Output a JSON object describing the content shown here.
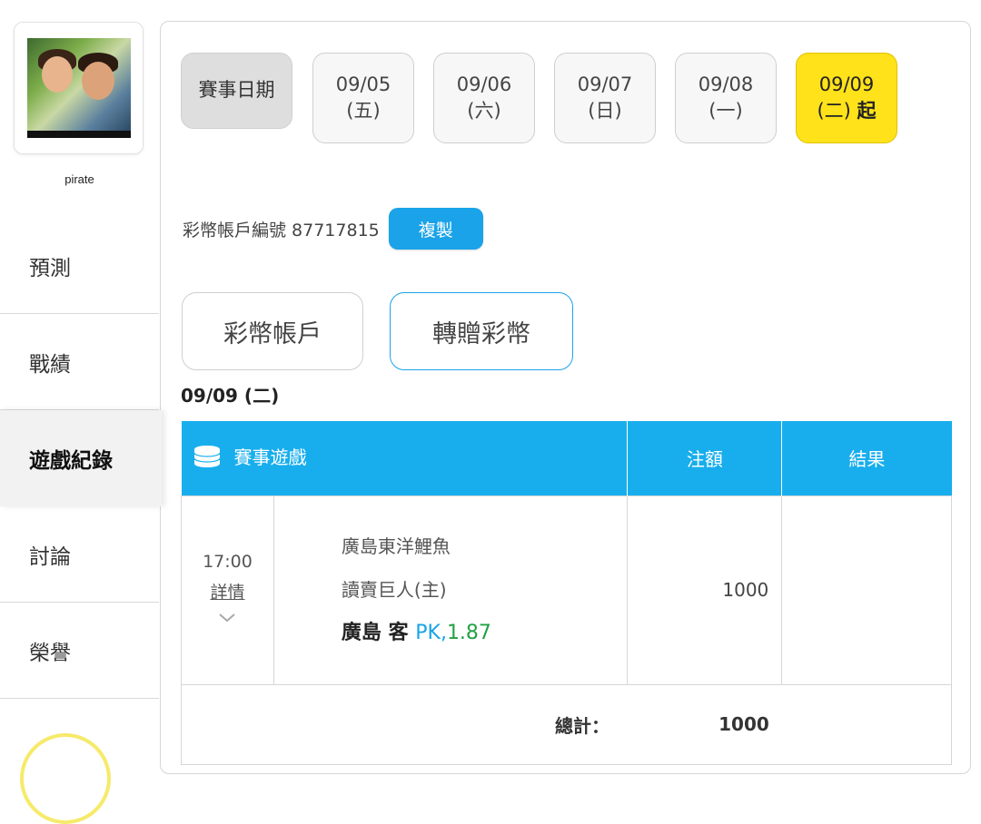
{
  "user": {
    "name": "pirate"
  },
  "nav": {
    "items": [
      {
        "label": "預測"
      },
      {
        "label": "戰績"
      },
      {
        "label": "遊戲紀錄"
      },
      {
        "label": "討論"
      },
      {
        "label": "榮譽"
      }
    ],
    "active": "遊戲紀錄"
  },
  "dates": {
    "label": "賽事日期",
    "items": [
      {
        "date": "09/05",
        "weekday": "(五)"
      },
      {
        "date": "09/06",
        "weekday": "(六)"
      },
      {
        "date": "09/07",
        "weekday": "(日)"
      },
      {
        "date": "09/08",
        "weekday": "(一)"
      },
      {
        "date": "09/09",
        "weekday": "(二)",
        "suffix": "起"
      }
    ],
    "selected": "09/09"
  },
  "account": {
    "label": "彩幣帳戶編號 87717815",
    "copy_label": "複製"
  },
  "tabs": [
    {
      "label": "彩幣帳戶"
    },
    {
      "label": "轉贈彩幣"
    }
  ],
  "section_date": "09/09 (二)",
  "table": {
    "headers": {
      "game": "賽事遊戲",
      "bet": "注額",
      "result": "結果"
    },
    "rows": [
      {
        "time": "17:00",
        "detail_label": "詳情",
        "away": "廣島東洋鯉魚",
        "home": "讀賣巨人(主)",
        "pick_team": "廣島 客",
        "pick_type": "PK,",
        "pick_odds": "1.87",
        "bet": "1000",
        "result": ""
      }
    ],
    "total_label": "總計：",
    "total_value": "1000"
  },
  "colors": {
    "accent": "#18aeed",
    "selected_date": "#ffe21a",
    "odds": "#21a144"
  }
}
